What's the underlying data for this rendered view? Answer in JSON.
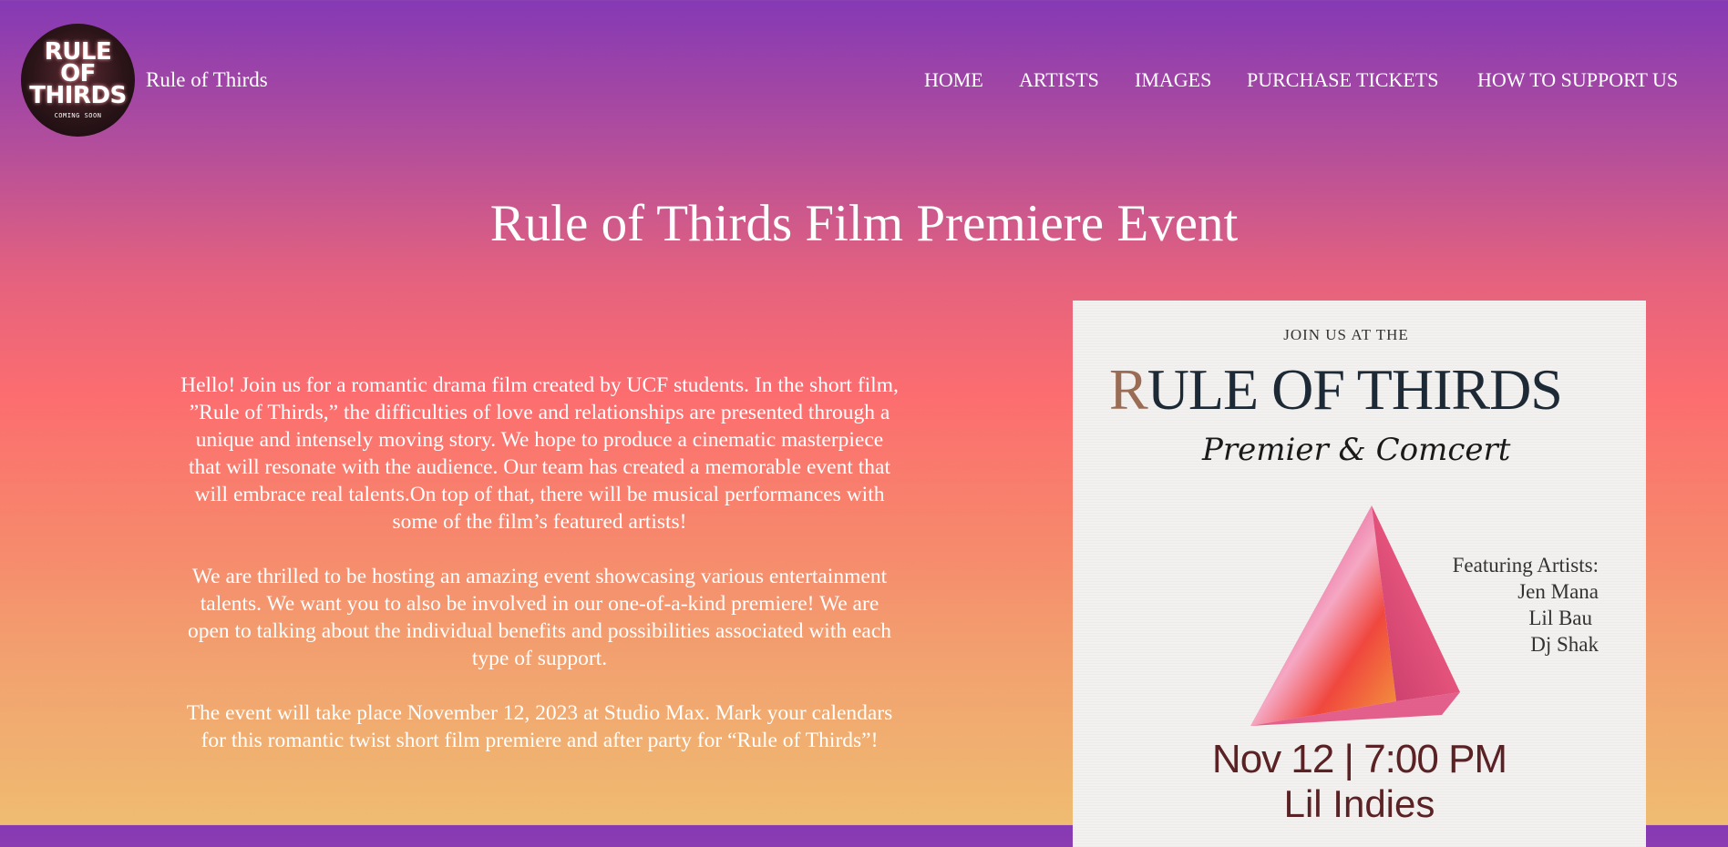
{
  "header": {
    "logo": {
      "line1": "RULE",
      "line2": "OF",
      "line3": "THIRDS",
      "subtitle": "COMING SOON"
    },
    "site_title": "Rule of Thirds",
    "nav": [
      {
        "label": "HOME"
      },
      {
        "label": "ARTISTS"
      },
      {
        "label": "IMAGES"
      },
      {
        "label": "PURCHASE TICKETS"
      },
      {
        "label": "HOW TO SUPPORT US"
      }
    ]
  },
  "main": {
    "title": "Rule of Thirds Film Premiere Event",
    "paragraphs": [
      "Hello! Join us for a romantic drama film created by UCF students. In the short film, ”Rule of Thirds,” the difficulties of love and relationships are presented through a unique and intensely moving story. We hope to produce a cinematic masterpiece that will resonate with the audience. Our team has created a memorable event that will embrace real talents.On top of that, there will be musical performances with some of the film’s featured artists!",
      "We are thrilled to be hosting an amazing event showcasing various entertainment talents. We want you to also be involved in our one-of-a-kind premiere! We are open to talking about the individual benefits and possibilities associated with each type of support.",
      "The event will take place November 12, 2023 at Studio Max. Mark your calendars for this romantic twist short film premiere and after party for “Rule of Thirds”!"
    ]
  },
  "poster": {
    "join": "JOIN US AT THE",
    "title_first": "R",
    "title_rest": "ULE OF THIRDS",
    "script": "Premier & Comcert",
    "artists_heading": "Featuring Artists:",
    "artists": [
      "Jen Mana",
      "Lil Bau",
      "Dj Shak"
    ],
    "date_time": "Nov 12 | 7:00 PM",
    "venue": "Lil Indies"
  },
  "colors": {
    "gradient_top": "#8539b5",
    "gradient_mid": "#fc6d6f",
    "gradient_bottom": "#efbc71",
    "poster_bg": "#f3f1ef",
    "poster_accent": "#5a2224"
  },
  "icons": {
    "logo": "rule-of-thirds-logo-icon",
    "poster_art": "pyramid-icon"
  }
}
